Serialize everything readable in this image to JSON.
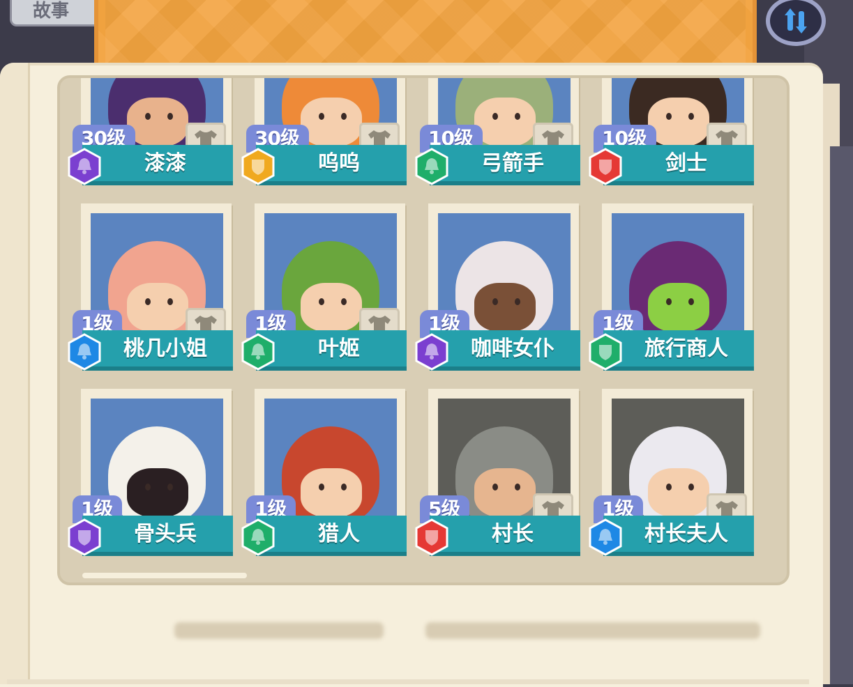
{
  "header": {
    "tab_label": "故事"
  },
  "colors": {
    "purple": "#7b3fd0",
    "gold": "#f0a91f",
    "green": "#1fae6a",
    "red": "#e53935",
    "blue": "#1e88e5"
  },
  "characters": [
    {
      "level": "30级",
      "name": "漆漆",
      "rarity_color": "purple",
      "badge_icon": "bell-icon",
      "outfit": true
    },
    {
      "level": "30级",
      "name": "呜呜",
      "rarity_color": "gold",
      "badge_icon": "shield-icon",
      "outfit": true
    },
    {
      "level": "10级",
      "name": "弓箭手",
      "rarity_color": "green",
      "badge_icon": "bell-icon",
      "outfit": true
    },
    {
      "level": "10级",
      "name": "剑士",
      "rarity_color": "red",
      "badge_icon": "shield-icon",
      "outfit": true
    },
    {
      "level": "1级",
      "name": "桃几小姐",
      "rarity_color": "blue",
      "badge_icon": "bell-icon",
      "outfit": true
    },
    {
      "level": "1级",
      "name": "叶姬",
      "rarity_color": "green",
      "badge_icon": "bell-icon",
      "outfit": true
    },
    {
      "level": "1级",
      "name": "咖啡女仆",
      "rarity_color": "purple",
      "badge_icon": "bell-icon",
      "outfit": false
    },
    {
      "level": "1级",
      "name": "旅行商人",
      "rarity_color": "green",
      "badge_icon": "shield-icon",
      "outfit": false
    },
    {
      "level": "1级",
      "name": "骨头兵",
      "rarity_color": "purple",
      "badge_icon": "shield-icon",
      "outfit": false
    },
    {
      "level": "1级",
      "name": "猎人",
      "rarity_color": "green",
      "badge_icon": "bell-icon",
      "outfit": false
    },
    {
      "level": "5级",
      "name": "村长",
      "rarity_color": "red",
      "badge_icon": "shield-icon",
      "outfit": true
    },
    {
      "level": "1级",
      "name": "村长夫人",
      "rarity_color": "blue",
      "badge_icon": "bell-icon",
      "outfit": true
    }
  ]
}
